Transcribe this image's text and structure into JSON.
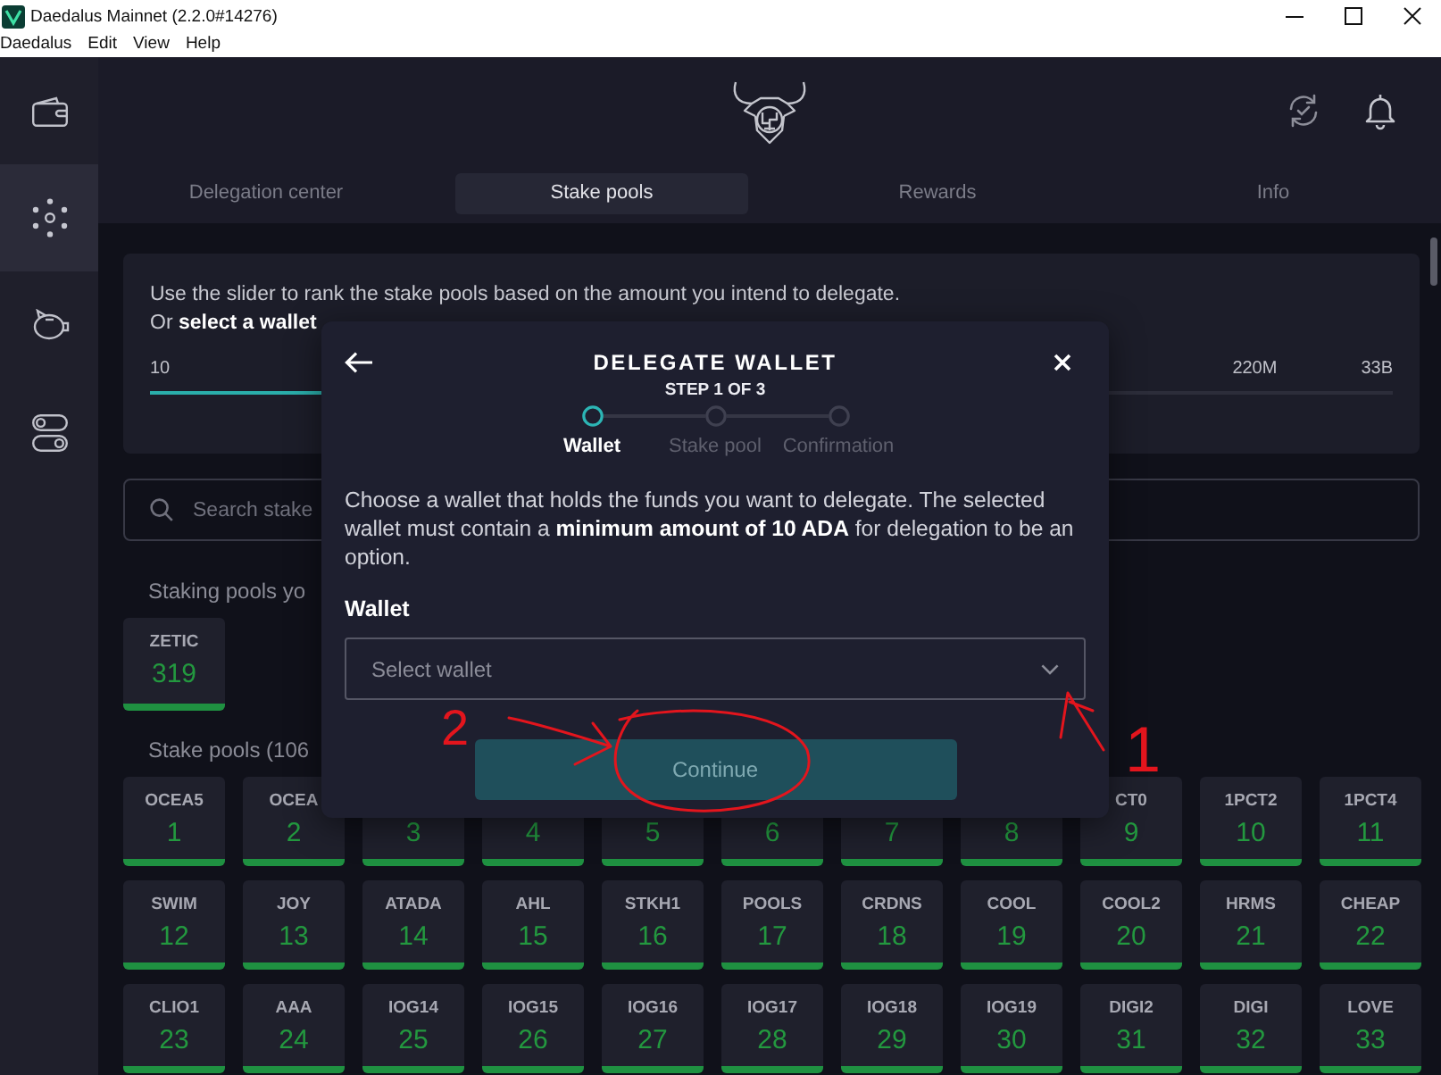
{
  "window": {
    "title": "Daedalus Mainnet (2.2.0#14276)"
  },
  "menu": [
    "Daedalus",
    "Edit",
    "View",
    "Help"
  ],
  "sidebar": {
    "items": [
      {
        "kind": "wallet",
        "selected": false
      },
      {
        "kind": "network",
        "selected": true
      },
      {
        "kind": "piggy",
        "selected": false
      },
      {
        "kind": "toggles",
        "selected": false
      }
    ]
  },
  "tabs": [
    {
      "label": "Delegation center",
      "selected": false
    },
    {
      "label": "Stake pools",
      "selected": true
    },
    {
      "label": "Rewards",
      "selected": false
    },
    {
      "label": "Info",
      "selected": false
    }
  ],
  "slider_panel": {
    "lines": [
      "Use the slider to rank the stake pools based on the amount you intend to delegate.",
      "Or **select a wallet**"
    ],
    "slider": {
      "level": 0.5,
      "labels": [
        "10",
        "220M",
        "33B"
      ]
    }
  },
  "search": {
    "placeholder": "Search stake"
  },
  "my_pools": {
    "heading": "Staking pools yo",
    "pools": [
      {
        "ticker": "ZETIC",
        "rank": "319"
      }
    ]
  },
  "stake_pools": {
    "heading": "Stake pools (106",
    "pools": [
      {
        "ticker": "OCEA5",
        "rank": "1"
      },
      {
        "ticker": "OCEA",
        "rank": "2"
      },
      {
        "rank": "3"
      },
      {
        "rank": "4"
      },
      {
        "rank": "5"
      },
      {
        "rank": "6"
      },
      {
        "rank": "7"
      },
      {
        "rank": "8"
      },
      {
        "ticker": "CT0",
        "rank": "9"
      },
      {
        "ticker": "1PCT2",
        "rank": "10"
      },
      {
        "ticker": "1PCT4",
        "rank": "11"
      },
      {
        "ticker": "SWIM",
        "rank": "12"
      },
      {
        "ticker": "JOY",
        "rank": "13"
      },
      {
        "ticker": "ATADA",
        "rank": "14"
      },
      {
        "ticker": "AHL",
        "rank": "15"
      },
      {
        "ticker": "STKH1",
        "rank": "16"
      },
      {
        "ticker": "POOLS",
        "rank": "17"
      },
      {
        "ticker": "CRDNS",
        "rank": "18"
      },
      {
        "ticker": "COOL",
        "rank": "19"
      },
      {
        "ticker": "COOL2",
        "rank": "20"
      },
      {
        "ticker": "HRMS",
        "rank": "21"
      },
      {
        "ticker": "CHEAP",
        "rank": "22"
      },
      {
        "ticker": "CLIO1",
        "rank": "23"
      },
      {
        "ticker": "AAA",
        "rank": "24"
      },
      {
        "ticker": "IOG14",
        "rank": "25"
      },
      {
        "ticker": "IOG15",
        "rank": "26"
      },
      {
        "ticker": "IOG16",
        "rank": "27"
      },
      {
        "ticker": "IOG17",
        "rank": "28"
      },
      {
        "ticker": "IOG18",
        "rank": "29"
      },
      {
        "ticker": "IOG19",
        "rank": "30"
      },
      {
        "ticker": "DIGI2",
        "rank": "31"
      },
      {
        "ticker": "DIGI",
        "rank": "32"
      },
      {
        "ticker": "LOVE",
        "rank": "33"
      }
    ]
  },
  "dialog": {
    "title": "DELEGATE WALLET",
    "step": "STEP 1 OF 3",
    "steps": [
      {
        "label": "Wallet",
        "active": true
      },
      {
        "label": "Stake pool",
        "active": false
      },
      {
        "label": "Confirmation",
        "active": false
      }
    ],
    "text": "Choose a wallet that holds the funds you want to delegate. The selected wallet must contain a **minimum amount of 10 ADA** for delegation to be an option.",
    "wallet_label": "Wallet",
    "wallet_select": {
      "placeholder": "Select wallet"
    },
    "button": {
      "label": "Continue",
      "disabled": true
    }
  },
  "annotations": [
    {
      "kind": "number",
      "text": "2"
    },
    {
      "kind": "arrow"
    },
    {
      "kind": "circle"
    },
    {
      "kind": "arrow"
    },
    {
      "kind": "number",
      "text": "1"
    }
  ]
}
